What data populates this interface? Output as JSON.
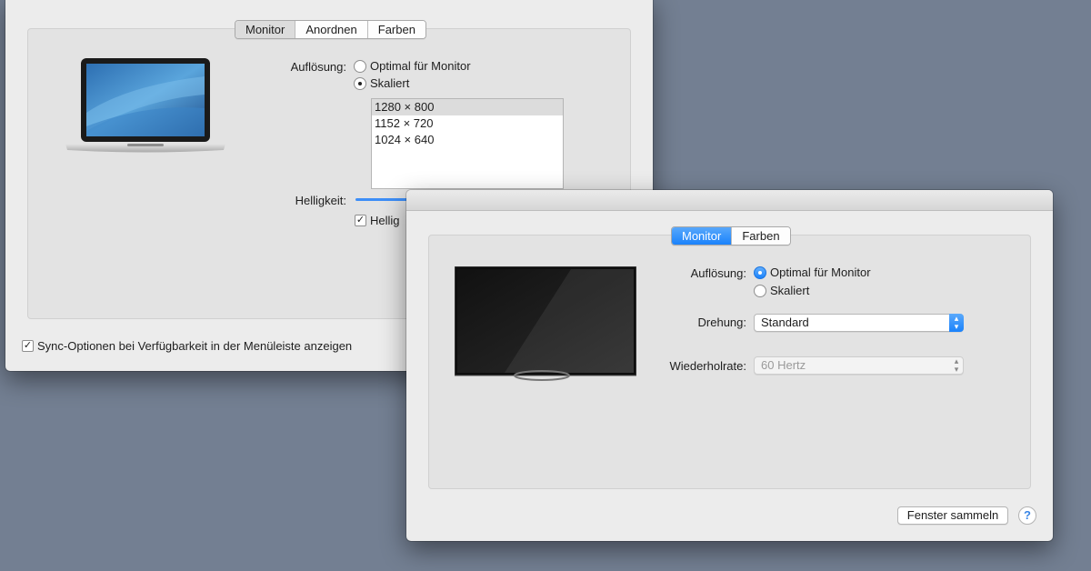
{
  "back_window": {
    "tabs": [
      {
        "label": "Monitor",
        "selected": true
      },
      {
        "label": "Anordnen",
        "selected": false
      },
      {
        "label": "Farben",
        "selected": false
      }
    ],
    "resolution_label": "Auflösung:",
    "resolution_options": [
      "Optimal für Monitor",
      "Skaliert"
    ],
    "resolution_selected": "Skaliert",
    "scaled_list": [
      "1280 × 800",
      "1152 × 720",
      "1024 × 640"
    ],
    "scaled_selected": "1280 × 800",
    "brightness_label": "Helligkeit:",
    "brightness_auto_label": "Hellig",
    "brightness_auto_checked": true,
    "sync_option_label": "Sync-Optionen bei Verfügbarkeit in der Menüleiste anzeigen",
    "sync_option_checked": true
  },
  "front_window": {
    "tabs": [
      {
        "label": "Monitor",
        "selected": true
      },
      {
        "label": "Farben",
        "selected": false
      }
    ],
    "resolution_label": "Auflösung:",
    "resolution_options": [
      "Optimal für Monitor",
      "Skaliert"
    ],
    "resolution_selected": "Optimal für Monitor",
    "rotation_label": "Drehung:",
    "rotation_value": "Standard",
    "refresh_label": "Wiederholrate:",
    "refresh_value": "60 Hertz",
    "gather_windows_button": "Fenster sammeln",
    "help_button": "?"
  },
  "colors": {
    "desktop_bg": "#737f92",
    "accent_blue": "#1a82fb"
  }
}
